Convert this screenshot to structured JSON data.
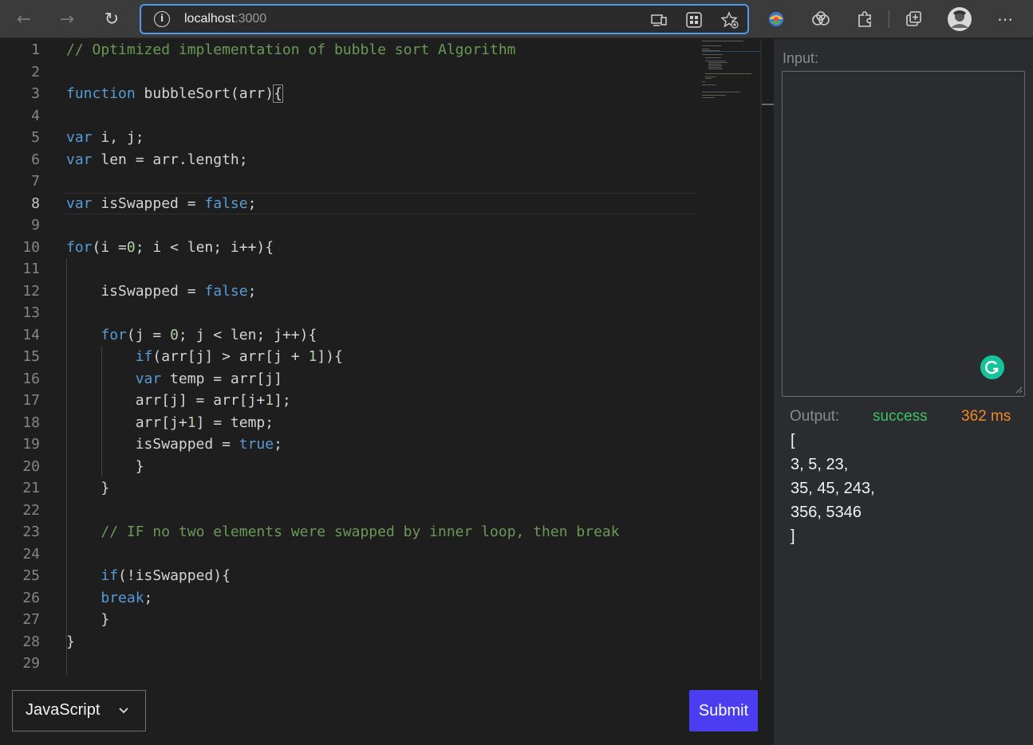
{
  "browser": {
    "url_host": "localhost",
    "url_port": ":3000"
  },
  "editor": {
    "active_line": 8,
    "lines": [
      {
        "n": "1"
      },
      {
        "n": "2"
      },
      {
        "n": "3"
      },
      {
        "n": "4"
      },
      {
        "n": "5"
      },
      {
        "n": "6"
      },
      {
        "n": "7"
      },
      {
        "n": "8"
      },
      {
        "n": "9"
      },
      {
        "n": "10"
      },
      {
        "n": "11"
      },
      {
        "n": "12"
      },
      {
        "n": "13"
      },
      {
        "n": "14"
      },
      {
        "n": "15"
      },
      {
        "n": "16"
      },
      {
        "n": "17"
      },
      {
        "n": "18"
      },
      {
        "n": "19"
      },
      {
        "n": "20"
      },
      {
        "n": "21"
      },
      {
        "n": "22"
      },
      {
        "n": "23"
      },
      {
        "n": "24"
      },
      {
        "n": "25"
      },
      {
        "n": "26"
      },
      {
        "n": "27"
      },
      {
        "n": "28"
      },
      {
        "n": "29"
      }
    ],
    "code": {
      "l1": "// Optimized implementation of bubble sort Algorithm",
      "l3_kw": "function",
      "l3_rest": " bubbleSort(arr)",
      "l3_brace": "{",
      "l5_kw": "var",
      "l5_rest": " i, j;",
      "l6_kw": "var",
      "l6_rest": " len = arr.length;",
      "l8_kw": "var",
      "l8_mid": " isSwapped = ",
      "l8_val": "false",
      "l8_end": ";",
      "l10_kw": "for",
      "l10_a": "(i =",
      "l10_num": "0",
      "l10_b": "; i < len; i++){",
      "l12_a": "    isSwapped = ",
      "l12_val": "false",
      "l12_end": ";",
      "l14_ind": "    ",
      "l14_kw": "for",
      "l14_a": "(j = ",
      "l14_num": "0",
      "l14_b": "; j < len; j++){",
      "l15_ind": "        ",
      "l15_kw": "if",
      "l15_a": "(arr[j] > arr[j + ",
      "l15_num": "1",
      "l15_b": "]){",
      "l16_ind": "        ",
      "l16_kw": "var",
      "l16_rest": " temp = arr[j]",
      "l17_a": "        arr[j] = arr[j+",
      "l17_num": "1",
      "l17_b": "];",
      "l18_a": "        arr[j+",
      "l18_num": "1",
      "l18_b": "] = temp;",
      "l19_a": "        isSwapped = ",
      "l19_val": "true",
      "l19_end": ";",
      "l20": "        }",
      "l21": "    }",
      "l23_ind": "    ",
      "l23": "// IF no two elements were swapped by inner loop, then break",
      "l25_ind": "    ",
      "l25_kw": "if",
      "l25_rest": "(!isSwapped){",
      "l26_ind": "    ",
      "l26_kw": "break",
      "l26_rest": ";",
      "l27": "    }",
      "l28": "}"
    }
  },
  "footer": {
    "language": "JavaScript",
    "submit_label": "Submit"
  },
  "panel": {
    "input_label": "Input:",
    "output_label": "Output:",
    "status": "success",
    "time": "362 ms",
    "output_lines": [
      "[",
      "3, 5, 23,",
      "35, 45, 243,",
      "356, 5346",
      "]"
    ]
  },
  "colors": {
    "keyword": "#569cd6",
    "comment": "#6a9955",
    "number": "#b5cea8",
    "success": "#3ec26a",
    "time": "#f08a2c",
    "submit": "#4b3df0",
    "address_border": "#4f9be8"
  }
}
